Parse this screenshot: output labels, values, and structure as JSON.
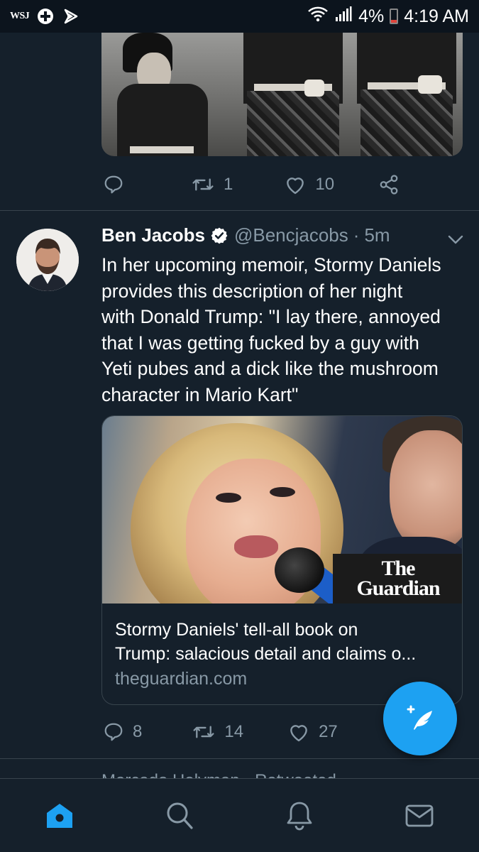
{
  "status_bar": {
    "left_app": "WSJ",
    "icons": [
      "wsj-app-icon",
      "medical-cross-icon",
      "flag-icon"
    ],
    "battery": "4%",
    "time": "4:19 AM",
    "status_icons": [
      "wifi-icon",
      "signal-icon",
      "battery-icon"
    ]
  },
  "tweets": [
    {
      "retweets": "1",
      "likes": "10"
    },
    {
      "display_name": "Ben Jacobs",
      "handle": "@Bencjacobs",
      "separator": "·",
      "time": "5m",
      "text_lines": [
        "In her upcoming memoir, Stormy Daniels",
        "provides this description of her night",
        "with Donald Trump: \"I lay there, annoyed",
        "that I was getting fucked by a guy with",
        "Yeti pubes and a dick like the mushroom",
        "character in Mario Kart\""
      ],
      "card": {
        "logo_line1": "The",
        "logo_line2": "Guardian",
        "title_lines": [
          "Stormy Daniels' tell-all book on",
          "Trump: salacious detail and claims o..."
        ],
        "domain": "theguardian.com"
      },
      "replies": "8",
      "retweets": "14",
      "likes": "27"
    }
  ],
  "peek": "Mercado Helyman · Retweeted",
  "nav": [
    "home-icon",
    "search-icon",
    "notifications-icon",
    "messages-icon"
  ],
  "colors": {
    "background": "#15202b",
    "accent": "#1da1f2",
    "muted": "#8899a6",
    "divider": "#38444d"
  }
}
